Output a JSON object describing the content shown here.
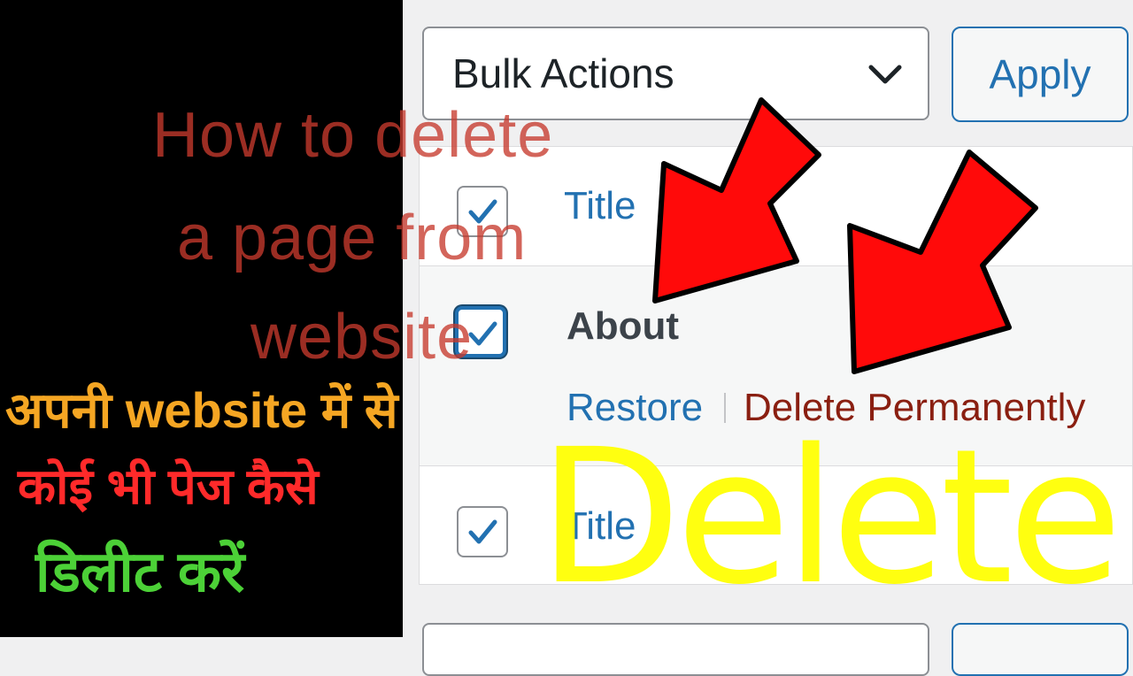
{
  "bulk_actions": {
    "label": "Bulk Actions",
    "apply_label": "Apply"
  },
  "table": {
    "header_title": "Title",
    "rows": [
      {
        "title": "About",
        "actions": {
          "restore": "Restore",
          "delete_permanently": "Delete Permanently"
        }
      }
    ],
    "footer_title": "Title"
  },
  "overlay": {
    "title_lines": [
      "How to delete",
      "a page from",
      "website"
    ],
    "hindi_lines": [
      "अपनी website में से",
      "कोई भी पेज कैसे",
      "डिलीट करें"
    ],
    "big_word": "Delete",
    "colors": {
      "title": "#c73a2e",
      "hindi_line1": "#f5a623",
      "hindi_line2": "#ff2a2a",
      "hindi_line3": "#4cd137",
      "big_word": "#ffff10",
      "arrow_fill": "#ff0a0a"
    }
  },
  "colors": {
    "link_blue": "#2271b1",
    "delete_red": "#8a1f11",
    "text_dark": "#3c434a"
  }
}
